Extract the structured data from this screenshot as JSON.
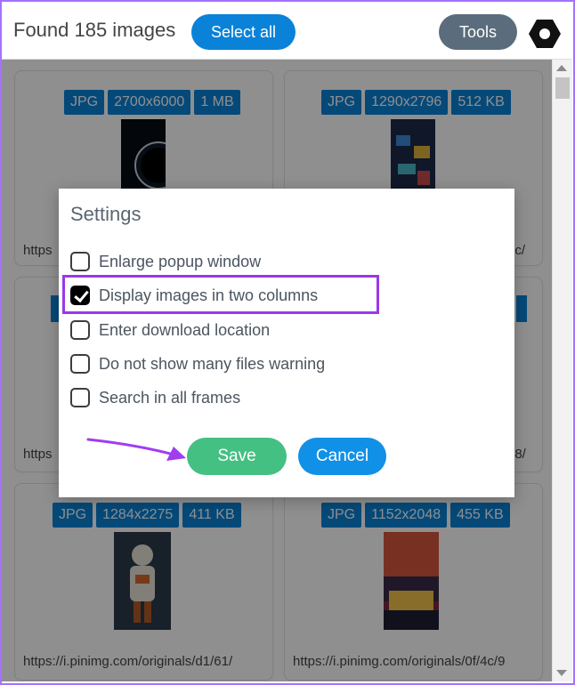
{
  "header": {
    "found_text": "Found 185 images",
    "select_all_label": "Select all",
    "tools_label": "Tools",
    "settings_icon": "gear-icon"
  },
  "cards": [
    {
      "type": "JPG",
      "dims": "2700x6000",
      "size": "1 MB",
      "url": "https"
    },
    {
      "type": "JPG",
      "dims": "1290x2796",
      "size": "512 KB",
      "url": "9c/"
    },
    {
      "url": "https"
    },
    {
      "url": "28/"
    },
    {
      "type": "JPG",
      "dims": "1284x2275",
      "size": "411 KB",
      "url": "https://i.pinimg.com/originals/d1/61/"
    },
    {
      "type": "JPG",
      "dims": "1152x2048",
      "size": "455 KB",
      "url": "https://i.pinimg.com/originals/0f/4c/9"
    }
  ],
  "settings": {
    "title": "Settings",
    "options": [
      {
        "label": "Enlarge popup window",
        "checked": false
      },
      {
        "label": "Display images in two columns",
        "checked": true
      },
      {
        "label": "Enter download location",
        "checked": false
      },
      {
        "label": "Do not show many files warning",
        "checked": false
      },
      {
        "label": "Search in all frames",
        "checked": false
      }
    ],
    "save_label": "Save",
    "cancel_label": "Cancel"
  },
  "colors": {
    "accent_blue": "#0a82d8",
    "save_green": "#45c083",
    "highlight_purple": "#9b38e8"
  }
}
